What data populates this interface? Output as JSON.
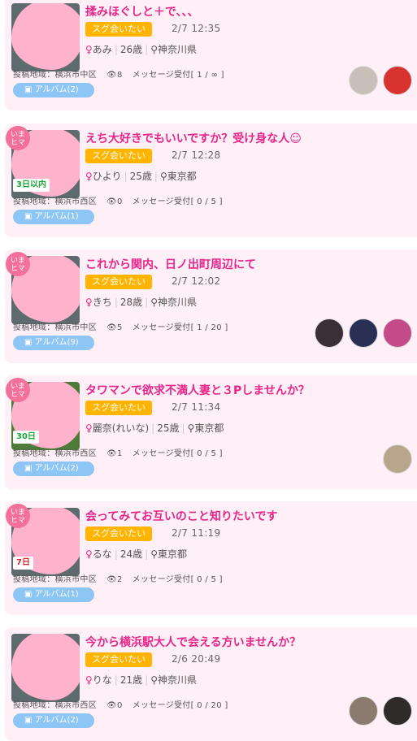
{
  "posts": [
    {
      "title": "揉みほぐしと＋で、、、",
      "tag": "スグ会いたい",
      "time": "2/7 12:35",
      "gender_icon": "♀",
      "name": "あみ",
      "age": "26歳",
      "pref": "神奈川県",
      "area_label": "投稿地域：横浜市中区",
      "views": "8",
      "msg": "メッセージ受付[ 1 / ∞ ]",
      "album": "アルバム(2)",
      "ima": "",
      "day_badge": "",
      "avatars": [
        "#c9bfb8",
        "#d9332f"
      ]
    },
    {
      "title": "えち大好きでもいいですか？受け身な人☺",
      "tag": "スグ会いたい",
      "time": "2/7 12:28",
      "gender_icon": "♀",
      "name": "ひより",
      "age": "25歳",
      "pref": "東京都",
      "area_label": "投稿地域：横浜市西区",
      "views": "0",
      "msg": "メッセージ受付[ 0 / 5 ]",
      "album": "アルバム(1)",
      "ima": "いま ヒマ",
      "day_badge": "3日以内",
      "avatars": []
    },
    {
      "title": "これから関内、日ノ出町周辺にて",
      "tag": "スグ会いたい",
      "time": "2/7 12:02",
      "gender_icon": "♀",
      "name": "きち",
      "age": "28歳",
      "pref": "神奈川県",
      "area_label": "投稿地域：横浜市中区",
      "views": "5",
      "msg": "メッセージ受付[ 1 / 20 ]",
      "album": "アルバム(9)",
      "ima": "いま ヒマ",
      "day_badge": "",
      "avatars": [
        "#3a2f35",
        "#2a2f55",
        "#c44a8a"
      ]
    },
    {
      "title": "タワマンで欲求不満人妻と３Pしませんか？",
      "tag": "スグ会いたい",
      "time": "2/7 11:34",
      "gender_icon": "♀",
      "name": "麗奈(れいな)",
      "age": "25歳",
      "pref": "東京都",
      "area_label": "投稿地域：横浜市西区",
      "views": "1",
      "msg": "メッセージ受付[ 0 / 5 ]",
      "album": "アルバム(2)",
      "ima": "いま ヒマ",
      "day_badge": "30日",
      "avatars": [
        "#b9a58c"
      ]
    },
    {
      "title": "会ってみてお互いのこと知りたいです",
      "tag": "スグ会いたい",
      "time": "2/7 11:19",
      "gender_icon": "♀",
      "name": "るな",
      "age": "24歳",
      "pref": "東京都",
      "area_label": "投稿地域：横浜市中区",
      "views": "2",
      "msg": "メッセージ受付[ 0 / 5 ]",
      "album": "アルバム(1)",
      "ima": "いま ヒマ",
      "day_badge": "7日",
      "avatars": []
    },
    {
      "title": "今から横浜駅大人で会える方いませんか？",
      "tag": "スグ会いたい",
      "time": "2/6 20:49",
      "gender_icon": "♀",
      "name": "りな",
      "age": "21歳",
      "pref": "神奈川県",
      "area_label": "投稿地域：横浜市西区",
      "views": "0",
      "msg": "メッセージ受付[ 0 / 20 ]",
      "album": "アルバム(2)",
      "ima": "",
      "day_badge": "",
      "avatars": [
        "#8a7b6e",
        "#2f2b2b"
      ]
    }
  ]
}
